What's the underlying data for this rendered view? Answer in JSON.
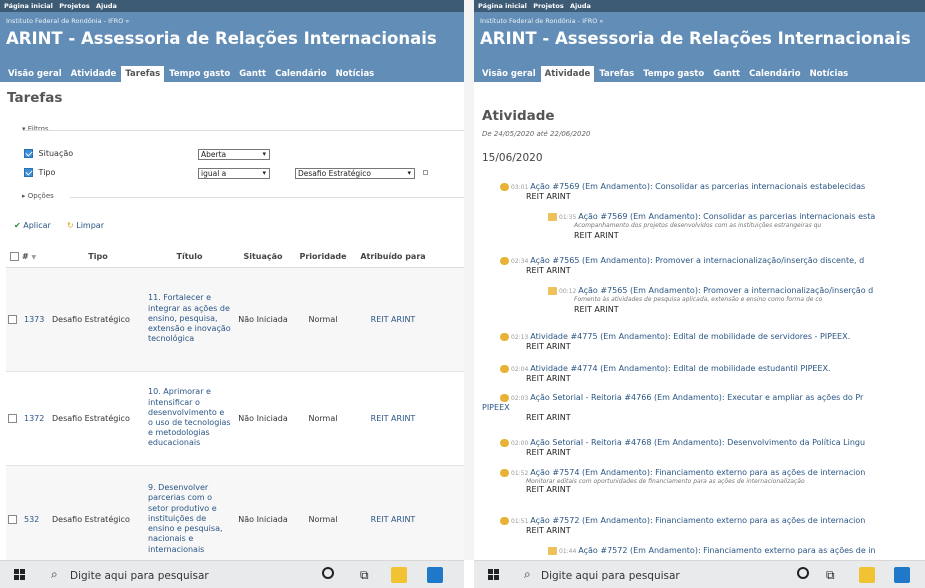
{
  "left": {
    "topmenu": [
      "Página inicial",
      "Projetos",
      "Ajuda"
    ],
    "subtitle": "Instituto Federal de Rondônia - IFRO »",
    "title": "ARINT - Assessoria de Relações Internacionais",
    "tabs": [
      "Visão geral",
      "Atividade",
      "Tarefas",
      "Tempo gasto",
      "Gantt",
      "Calendário",
      "Notícias"
    ],
    "page_title": "Tarefas",
    "filters_label": "Filtros",
    "filter_situacao": "Situação",
    "filter_situacao_value": "Aberta",
    "filter_tipo": "Tipo",
    "filter_tipo_op": "igual a",
    "filter_tipo_value": "Desafio Estratégico",
    "options_label": "Opções",
    "apply": "Aplicar",
    "clear": "Limpar",
    "columns": [
      "#",
      "Tipo",
      "Título",
      "Situação",
      "Prioridade",
      "Atribuído para"
    ],
    "rows": [
      {
        "id": "1373",
        "tipo": "Desafio Estratégico",
        "titulo": "11. Fortalecer e integrar as ações de ensino, pesquisa, extensão e inovação tecnológica",
        "situacao": "Não Iniciada",
        "prioridade": "Normal",
        "atribuido": "REIT ARINT"
      },
      {
        "id": "1372",
        "tipo": "Desafio Estratégico",
        "titulo": "10. Aprimorar e intensificar o desenvolvimento e o uso de tecnologias e metodologias educacionais",
        "situacao": "Não Iniciada",
        "prioridade": "Normal",
        "atribuido": "REIT ARINT"
      },
      {
        "id": "532",
        "tipo": "Desafio Estratégico",
        "titulo": "9. Desenvolver parcerias com o setor produtivo e instituições de ensino e pesquisa, nacionais e internacionais",
        "situacao": "Não Iniciada",
        "prioridade": "Normal",
        "atribuido": "REIT ARINT"
      }
    ],
    "taskbar_search": "Digite aqui para pesquisar"
  },
  "right": {
    "topmenu": [
      "Página inicial",
      "Projetos",
      "Ajuda"
    ],
    "subtitle": "Instituto Federal de Rondônia - IFRO »",
    "title": "ARINT - Assessoria de Relações Internacionais",
    "tabs": [
      "Visão geral",
      "Atividade",
      "Tarefas",
      "Tempo gasto",
      "Gantt",
      "Calendário",
      "Notícias"
    ],
    "page_title": "Atividade",
    "date_range": "De 24/05/2020 até 22/06/2020",
    "day": "15/06/2020",
    "entries": [
      {
        "time": "03:01",
        "text": "Ação #7569 (Em Andamento): Consolidar as parcerias internacionais estabelecidas",
        "by": "REIT ARINT",
        "desc": ""
      },
      {
        "time": "01:35",
        "text": "Ação #7569 (Em Andamento): Consolidar as parcerias internacionais esta",
        "by": "REIT ARINT",
        "desc": "Acompanhamento dos projetos desenvolvidos com as instituições estrangeiras qu"
      },
      {
        "time": "02:34",
        "text": "Ação #7565 (Em Andamento): Promover a internacionalização/inserção discente, d",
        "by": "REIT ARINT",
        "desc": ""
      },
      {
        "time": "00:12",
        "text": "Ação #7565 (Em Andamento): Promover a internacionalização/inserção d",
        "by": "REIT ARINT",
        "desc": "Fomento às atividades de pesquisa aplicada, extensão e ensino como forma de co"
      },
      {
        "time": "02:13",
        "text": "Atividade #4775 (Em Andamento): Edital de mobilidade de servidores - PIPEEX.",
        "by": "REIT ARINT",
        "desc": ""
      },
      {
        "time": "02:04",
        "text": "Atividade #4774 (Em Andamento): Edital de mobilidade estudantil PIPEEX.",
        "by": "REIT ARINT",
        "desc": ""
      },
      {
        "time": "02:03",
        "text": "Ação Setorial - Reitoria #4766 (Em Andamento): Executar e ampliar as ações do Pr",
        "by": "REIT ARINT",
        "desc": "",
        "extra": "PIPEEX"
      },
      {
        "time": "02:00",
        "text": "Ação Setorial - Reitoria #4768 (Em Andamento): Desenvolvimento da Política Lingu",
        "by": "REIT ARINT",
        "desc": ""
      },
      {
        "time": "01:52",
        "text": "Ação #7574 (Em Andamento): Financiamento externo para as ações de internacion",
        "by": "REIT ARINT",
        "desc": "Monitorar editais com oportunidades de financiamento para as ações de internacionalização"
      },
      {
        "time": "01:51",
        "text": "Ação #7572 (Em Andamento): Financiamento externo para as ações de internacion",
        "by": "REIT ARINT",
        "desc": ""
      },
      {
        "time": "01:44",
        "text": "Ação #7572 (Em Andamento): Financiamento externo para as ações de in",
        "by": "",
        "desc": ""
      }
    ],
    "taskbar_search": "Digite aqui para pesquisar"
  }
}
